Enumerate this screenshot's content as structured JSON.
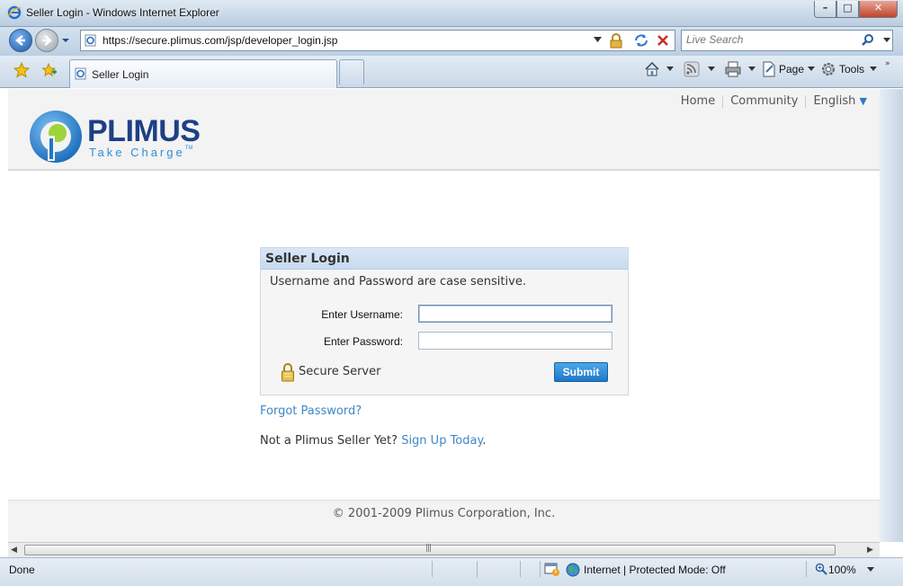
{
  "window": {
    "title": "Seller Login - Windows Internet Explorer",
    "minimize": "–",
    "maximize": "□",
    "close": "✕"
  },
  "navbar": {
    "address": "https://secure.plimus.com/jsp/developer_login.jsp",
    "search_placeholder": "Live Search"
  },
  "tabs": [
    {
      "label": "Seller Login",
      "active": true
    }
  ],
  "commandbar": {
    "page_label": "Page",
    "tools_label": "Tools"
  },
  "site": {
    "nav": {
      "home": "Home",
      "community": "Community",
      "language": "English",
      "language_arrow": "▼"
    },
    "logo": {
      "word": "PLIMUS",
      "tagline": "Take Charge",
      "tm": "TM"
    },
    "login": {
      "title": "Seller Login",
      "case_note": "Username and Password are case sensitive.",
      "username_label": "Enter Username:",
      "password_label": "Enter Password:",
      "username_value": "",
      "password_value": "",
      "secure_label": "Secure Server",
      "submit_label": "Submit"
    },
    "forgot": "Forgot Password?",
    "signup_prefix": "Not a Plimus Seller Yet?",
    "signup_link": "Sign Up Today",
    "signup_suffix": ".",
    "copyright": "© 2001-2009 Plimus Corporation, Inc."
  },
  "statusbar": {
    "status": "Done",
    "zone": "Internet | Protected Mode: Off",
    "zoom": "100%"
  },
  "colors": {
    "logo_blue": "#1d3f86",
    "link_blue": "#3e87c9",
    "submit_blue": "#1f78c8",
    "login_header": "#c7dbf0"
  }
}
